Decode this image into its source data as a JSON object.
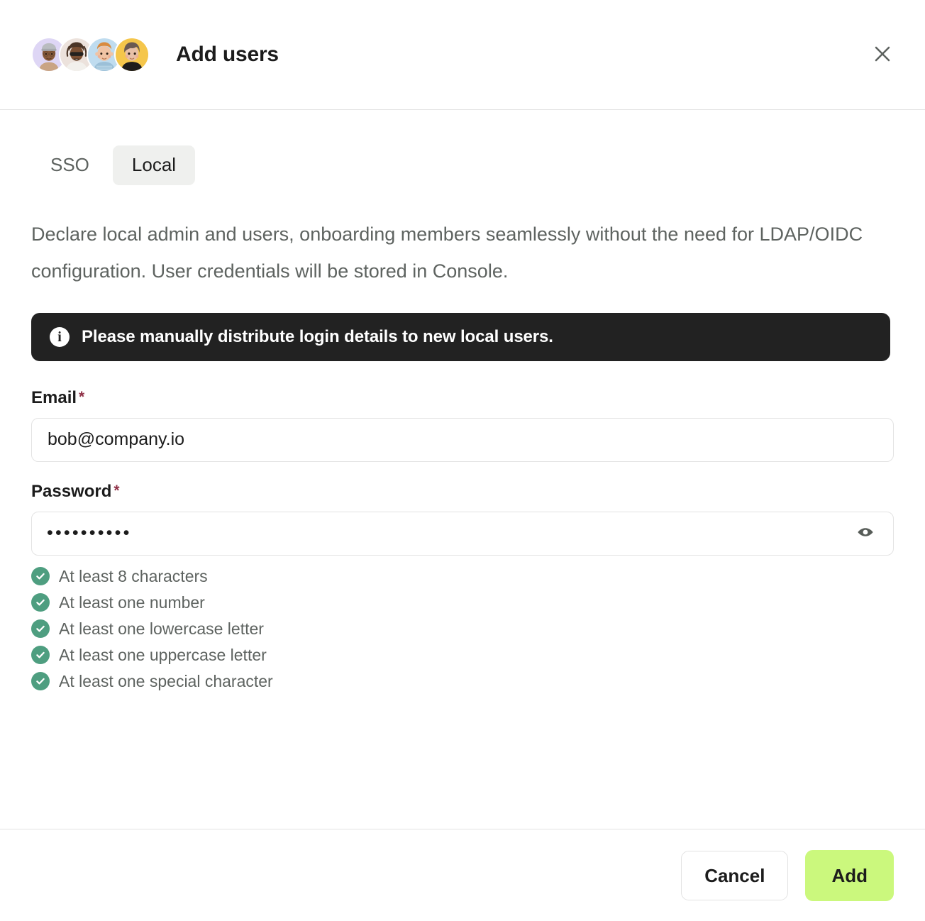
{
  "header": {
    "title": "Add users",
    "close_label": "×",
    "close_icon": "close-icon",
    "avatars": [
      {
        "name": "avatar-1",
        "bg": "#ded6f5",
        "skin": "#8a5b3c",
        "hair": "#3a2a20",
        "accessory": "beanie",
        "accessory_color": "#b9bcc0",
        "top": "#c9a484"
      },
      {
        "name": "avatar-2",
        "bg": "#ece2dc",
        "skin": "#7a4f33",
        "hair": "#4a3426",
        "accessory": "sunglasses",
        "accessory_color": "#23211f",
        "top": "#f2f0ec"
      },
      {
        "name": "avatar-3",
        "bg": "#bfdcef",
        "skin": "#f0c3a4",
        "hair": "#d98b3f",
        "accessory": "none",
        "accessory_color": "#23211f",
        "top": "#9cc0d8"
      },
      {
        "name": "avatar-4",
        "bg": "#f5c64b",
        "skin": "#e8c0a8",
        "hair": "#6b5a52",
        "accessory": "none",
        "accessory_color": "#23211f",
        "top": "#1e1c1b"
      }
    ]
  },
  "tabs": [
    {
      "id": "sso",
      "label": "SSO",
      "active": false
    },
    {
      "id": "local",
      "label": "Local",
      "active": true
    }
  ],
  "body": {
    "description": "Declare local admin and users, onboarding members seamlessly without the need for LDAP/OIDC configuration. User credentials will be stored in Console.",
    "alert": {
      "icon": "info-icon",
      "icon_glyph": "i",
      "text": "Please manually distribute login details to new local users.",
      "background": "#222222",
      "text_color": "#ffffff"
    },
    "email_field": {
      "label": "Email",
      "required_marker": "*",
      "value": "bob@company.io",
      "placeholder": "Email"
    },
    "password_field": {
      "label": "Password",
      "required_marker": "*",
      "masked_value": "••••••••••",
      "placeholder": "Password",
      "reveal_icon": "eye-icon"
    },
    "password_requirements": [
      {
        "label": "At least 8 characters",
        "met": true
      },
      {
        "label": "At least one number",
        "met": true
      },
      {
        "label": "At least one lowercase letter",
        "met": true
      },
      {
        "label": "At least one uppercase letter",
        "met": true
      },
      {
        "label": "At least one special character",
        "met": true
      }
    ]
  },
  "footer": {
    "cancel_label": "Cancel",
    "add_label": "Add"
  },
  "colors": {
    "accent_green": "#cbf87d",
    "check_green": "#4e9e80",
    "required_red": "#8f3047",
    "muted_text": "#5e6360",
    "border": "#e3e3e3",
    "tab_active_bg": "#eff0ee"
  }
}
